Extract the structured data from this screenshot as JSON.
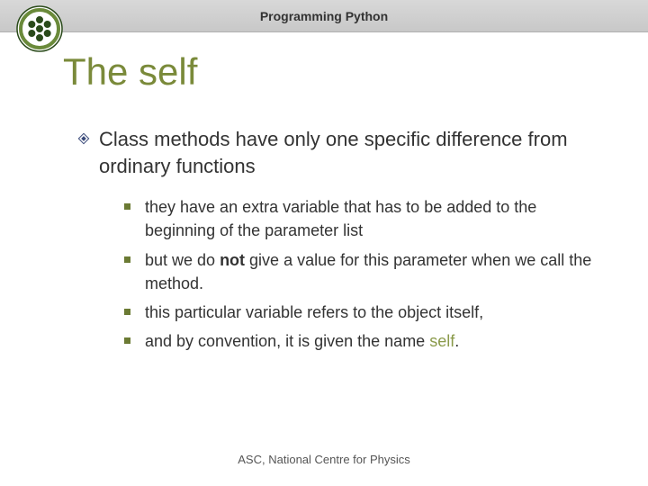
{
  "header": {
    "title": "Programming Python"
  },
  "slide": {
    "title": "The self"
  },
  "bullets": {
    "main": "Class methods have only one specific difference from ordinary functions",
    "sub1": "they have an extra variable that has to be added to the beginning of the parameter list",
    "sub2_pre": "but we do ",
    "sub2_bold": "not",
    "sub2_post": " give a value for this parameter when we call the method.",
    "sub3": "this particular variable refers to the object itself,",
    "sub4_pre": "and by convention, it is given the name ",
    "sub4_self": "self",
    "sub4_post": "."
  },
  "footer": {
    "text": "ASC, National Centre for Physics"
  }
}
